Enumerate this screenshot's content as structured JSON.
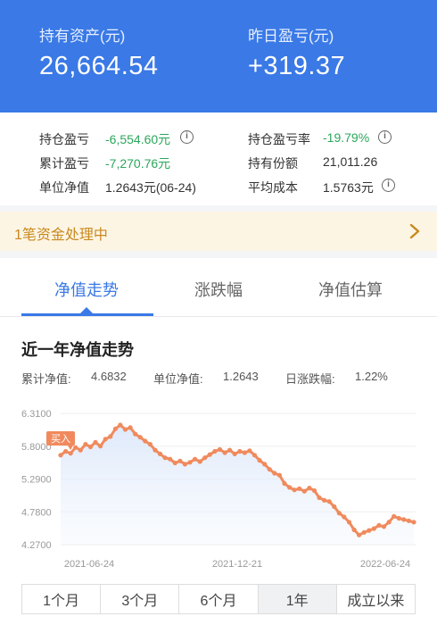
{
  "header": {
    "assets_label": "持有资产(元)",
    "assets_value": "26,664.54",
    "yesterday_label": "昨日盈亏(元)",
    "yesterday_value": "+319.37"
  },
  "stats": {
    "position_pl_label": "持仓盈亏",
    "position_pl_value": "-6,554.60元",
    "position_pl_rate_label": "持仓盈亏率",
    "position_pl_rate_value": "-19.79%",
    "cumulative_pl_label": "累计盈亏",
    "cumulative_pl_value": "-7,270.76元",
    "shares_label": "持有份额",
    "shares_value": "21,011.26",
    "nav_label": "单位净值",
    "nav_value": "1.2643元(06-24)",
    "avg_cost_label": "平均成本",
    "avg_cost_value": "1.5763元",
    "info_glyph": "i"
  },
  "notice": {
    "text": "1笔资金处理中"
  },
  "tabs": [
    "净值走势",
    "涨跌幅",
    "净值估算"
  ],
  "section": {
    "title": "近一年净值走势",
    "metric1_label": "累计净值:",
    "metric1_value": "4.6832",
    "metric2_label": "单位净值:",
    "metric2_value": "1.2643",
    "metric3_label": "日涨跌幅:",
    "metric3_value": "1.22%"
  },
  "range_buttons": [
    "1个月",
    "3个月",
    "6个月",
    "1年",
    "成立以来"
  ],
  "colors": {
    "primary": "#3a79e6",
    "line": "#f08a5d",
    "loss": "#2aa65b",
    "notice": "#c8891f"
  },
  "chart_data": {
    "type": "line",
    "y_ticks": [
      "6.3100",
      "5.8000",
      "5.2900",
      "4.7800",
      "4.2700"
    ],
    "x_ticks": [
      "2021-06-24",
      "2021-12-21",
      "2022-06-24"
    ],
    "ylim": [
      4.27,
      6.31
    ],
    "buy_marker": "买入",
    "values": [
      5.66,
      5.72,
      5.69,
      5.78,
      5.74,
      5.83,
      5.79,
      5.86,
      5.8,
      5.91,
      5.95,
      6.07,
      6.13,
      6.06,
      6.09,
      5.99,
      5.94,
      5.88,
      5.83,
      5.74,
      5.68,
      5.62,
      5.6,
      5.54,
      5.57,
      5.52,
      5.55,
      5.6,
      5.56,
      5.62,
      5.67,
      5.72,
      5.75,
      5.7,
      5.74,
      5.68,
      5.72,
      5.7,
      5.73,
      5.66,
      5.58,
      5.52,
      5.44,
      5.38,
      5.35,
      5.22,
      5.16,
      5.12,
      5.14,
      5.1,
      5.15,
      5.11,
      5.0,
      4.96,
      4.94,
      4.86,
      4.76,
      4.7,
      4.62,
      4.5,
      4.42,
      4.46,
      4.49,
      4.52,
      4.57,
      4.55,
      4.62,
      4.71,
      4.68,
      4.66,
      4.64,
      4.62
    ]
  }
}
